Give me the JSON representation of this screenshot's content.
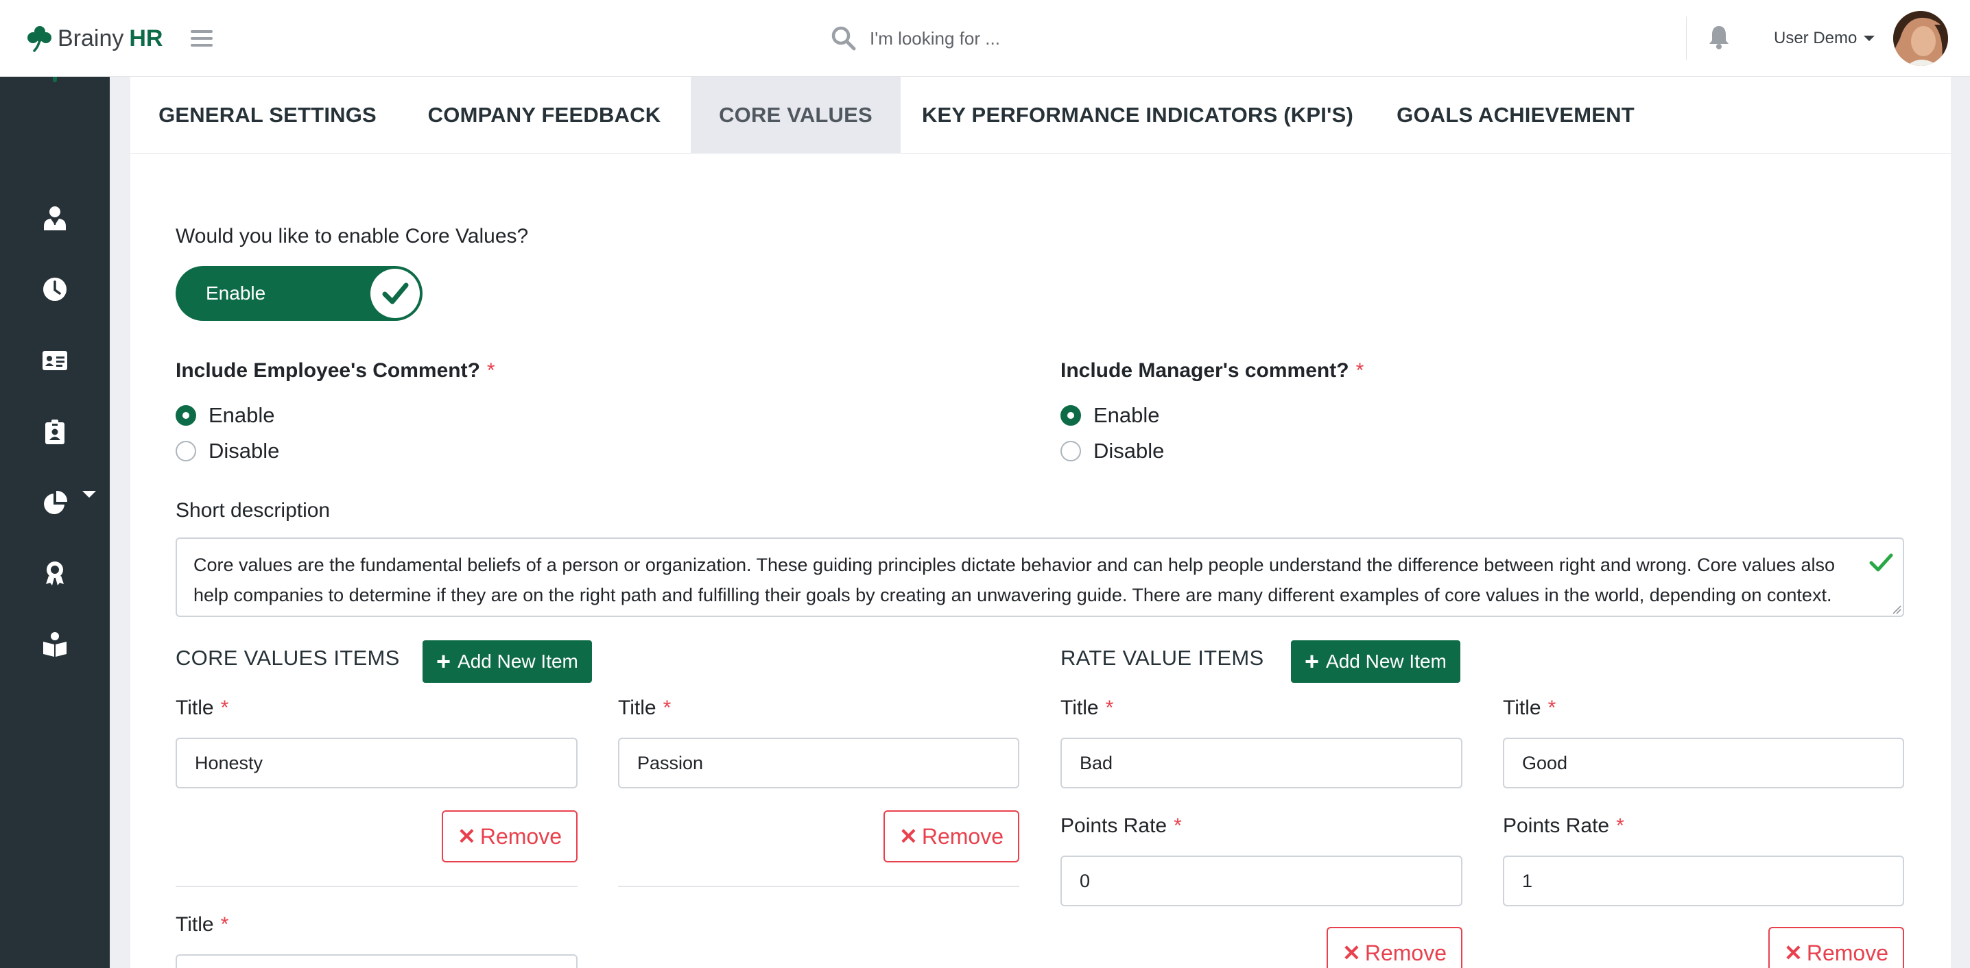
{
  "header": {
    "logo_name": "Brainy",
    "logo_accent": "HR",
    "search_placeholder": "I'm looking for ...",
    "user_name": "User Demo"
  },
  "sidebar": {
    "items": [
      {
        "icon": "user-tie-icon"
      },
      {
        "icon": "clock-icon"
      },
      {
        "icon": "id-card-icon"
      },
      {
        "icon": "id-badge-icon"
      },
      {
        "icon": "pie-chart-icon"
      },
      {
        "icon": "award-icon"
      },
      {
        "icon": "book-reader-icon"
      }
    ]
  },
  "tabs": [
    {
      "label": "GENERAL SETTINGS",
      "active": false
    },
    {
      "label": "COMPANY FEEDBACK",
      "active": false
    },
    {
      "label": "CORE VALUES",
      "active": true
    },
    {
      "label": "KEY PERFORMANCE INDICATORS (KPI'S)",
      "active": false
    },
    {
      "label": "GOALS ACHIEVEMENT",
      "active": false
    }
  ],
  "core_values": {
    "question": "Would you like to enable Core Values?",
    "toggle_label": "Enable",
    "toggle_on": true
  },
  "employee_comment": {
    "label": "Include Employee's Comment?",
    "required": "*",
    "options": [
      "Enable",
      "Disable"
    ],
    "selected": "Enable"
  },
  "manager_comment": {
    "label": "Include Manager's comment?",
    "required": "*",
    "options": [
      "Enable",
      "Disable"
    ],
    "selected": "Enable"
  },
  "short_description": {
    "label": "Short description",
    "value": "Core values are the fundamental beliefs of a person or organization. These guiding principles dictate behavior and can help people understand the difference between right and wrong. Core values also help companies to determine if they are on the right path and fulfilling their goals by creating an unwavering guide. There are many different examples of core values in the world, depending on context."
  },
  "core_values_items": {
    "heading": "CORE VALUES ITEMS",
    "add_label": "Add New Item",
    "title_label": "Title",
    "required": "*",
    "remove_label": "Remove",
    "items": [
      "Honesty",
      "Passion",
      ""
    ]
  },
  "rate_value_items": {
    "heading": "RATE VALUE ITEMS",
    "add_label": "Add New Item",
    "title_label": "Title",
    "points_label": "Points Rate",
    "required": "*",
    "remove_label": "Remove",
    "items": [
      {
        "title": "Bad",
        "points": "0"
      },
      {
        "title": "Good",
        "points": "1"
      }
    ]
  },
  "colors": {
    "brand_green": "#0e6b47",
    "sidebar_bg": "#263238",
    "danger_red": "#e8414d",
    "success_check": "#28a745"
  }
}
